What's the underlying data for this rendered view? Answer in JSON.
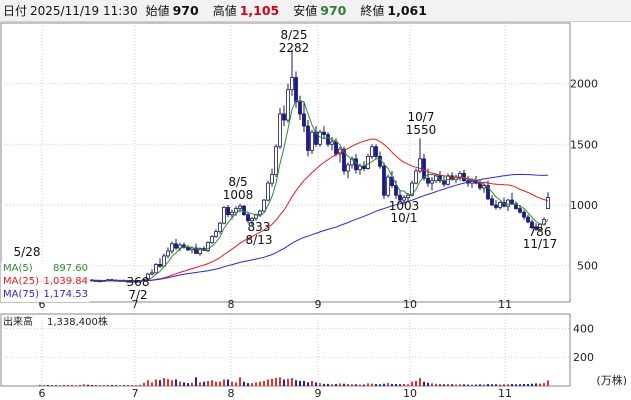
{
  "header": {
    "date_label": "日付",
    "date": "2025/11/19 11:30",
    "open_label": "始値",
    "open": "970",
    "high_label": "高値",
    "high": "1,105",
    "low_label": "安値",
    "low": "970",
    "close_label": "終値",
    "close": "1,061"
  },
  "colors": {
    "high": "#d0021b",
    "low": "#2e7d32",
    "up_candle": "#ffffff",
    "down_candle": "#1a1aa0",
    "ma5": "#2e8b2e",
    "ma25": "#e02020",
    "ma75": "#2a2ad0",
    "vol_up": "#e03030",
    "vol_down": "#2020a0"
  },
  "legend": [
    {
      "name": "MA(5)",
      "value": "897.60",
      "key": "ma5"
    },
    {
      "name": "MA(25)",
      "value": "1,039.84",
      "key": "ma25"
    },
    {
      "name": "MA(75)",
      "value": "1,174.53",
      "key": "ma75"
    }
  ],
  "volume_legend": {
    "label": "出来高",
    "value": "1,338,400株"
  },
  "chart_data": {
    "type": "candlestick",
    "x_ticks": [
      "6",
      "7",
      "8",
      "9",
      "10",
      "11"
    ],
    "price_ticks": [
      500,
      1000,
      1500,
      2000
    ],
    "ylim": [
      200,
      2500
    ],
    "volume_ticks": [
      200,
      400
    ],
    "volume_unit": "(万株)",
    "volume_ylim": [
      0,
      500
    ],
    "annotations": [
      {
        "date": "5/28",
        "value": ""
      },
      {
        "date": "7/2",
        "value": "368"
      },
      {
        "date": "8/5",
        "value": "1008"
      },
      {
        "date": "8/13",
        "value": "833"
      },
      {
        "date": "8/25",
        "value": "2282"
      },
      {
        "date": "10/1",
        "value": "1003"
      },
      {
        "date": "10/7",
        "value": "1550"
      },
      {
        "date": "11/17",
        "value": "786"
      }
    ],
    "candles": [
      [
        40,
        370,
        378,
        364,
        372,
        8
      ],
      [
        44,
        372,
        380,
        366,
        375,
        6
      ],
      [
        48,
        375,
        382,
        368,
        371,
        7
      ],
      [
        52,
        371,
        378,
        365,
        369,
        5
      ],
      [
        56,
        369,
        375,
        362,
        368,
        6
      ],
      [
        60,
        368,
        374,
        361,
        370,
        5
      ],
      [
        64,
        370,
        380,
        366,
        376,
        7
      ],
      [
        68,
        376,
        385,
        370,
        379,
        8
      ],
      [
        72,
        379,
        386,
        372,
        373,
        6
      ],
      [
        76,
        373,
        380,
        367,
        374,
        5
      ],
      [
        80,
        374,
        382,
        369,
        380,
        7
      ],
      [
        84,
        380,
        395,
        375,
        388,
        12
      ],
      [
        88,
        388,
        398,
        378,
        382,
        9
      ],
      [
        92,
        382,
        390,
        374,
        377,
        7
      ],
      [
        96,
        377,
        384,
        370,
        372,
        6
      ],
      [
        100,
        372,
        379,
        366,
        375,
        5
      ],
      [
        104,
        375,
        382,
        369,
        378,
        6
      ],
      [
        108,
        378,
        390,
        372,
        384,
        8
      ],
      [
        112,
        384,
        392,
        376,
        380,
        7
      ],
      [
        116,
        380,
        386,
        372,
        375,
        6
      ],
      [
        120,
        375,
        382,
        368,
        378,
        5
      ],
      [
        124,
        378,
        385,
        370,
        372,
        6
      ],
      [
        128,
        372,
        378,
        366,
        370,
        5
      ],
      [
        132,
        370,
        375,
        365,
        371,
        6
      ],
      [
        136,
        371,
        378,
        366,
        370,
        5
      ],
      [
        140,
        370,
        376,
        365,
        372,
        8
      ],
      [
        144,
        372,
        390,
        368,
        385,
        22
      ],
      [
        148,
        385,
        440,
        380,
        430,
        40
      ],
      [
        152,
        430,
        470,
        420,
        440,
        25
      ],
      [
        156,
        440,
        520,
        435,
        510,
        45
      ],
      [
        160,
        510,
        560,
        480,
        495,
        40
      ],
      [
        164,
        495,
        600,
        490,
        580,
        55
      ],
      [
        168,
        580,
        650,
        560,
        620,
        48
      ],
      [
        172,
        620,
        700,
        600,
        680,
        40
      ],
      [
        176,
        680,
        720,
        630,
        645,
        45
      ],
      [
        180,
        645,
        690,
        620,
        670,
        30
      ],
      [
        184,
        670,
        690,
        640,
        650,
        25
      ],
      [
        188,
        650,
        670,
        620,
        630,
        20
      ],
      [
        192,
        630,
        660,
        600,
        645,
        22
      ],
      [
        196,
        645,
        680,
        620,
        600,
        60
      ],
      [
        200,
        600,
        650,
        580,
        640,
        25
      ],
      [
        204,
        640,
        660,
        620,
        625,
        30
      ],
      [
        208,
        625,
        700,
        610,
        690,
        35
      ],
      [
        212,
        690,
        750,
        680,
        740,
        40
      ],
      [
        216,
        740,
        800,
        730,
        780,
        30
      ],
      [
        220,
        780,
        860,
        760,
        850,
        30
      ],
      [
        224,
        850,
        990,
        840,
        980,
        45
      ],
      [
        228,
        980,
        1000,
        900,
        920,
        45
      ],
      [
        232,
        920,
        960,
        880,
        940,
        30
      ],
      [
        236,
        940,
        990,
        910,
        970,
        25
      ],
      [
        240,
        970,
        1008,
        940,
        990,
        60
      ],
      [
        244,
        990,
        1000,
        910,
        920,
        30
      ],
      [
        248,
        920,
        940,
        850,
        870,
        20
      ],
      [
        252,
        870,
        900,
        833,
        890,
        20
      ],
      [
        256,
        890,
        930,
        870,
        920,
        25
      ],
      [
        260,
        920,
        960,
        900,
        950,
        30
      ],
      [
        264,
        950,
        1050,
        940,
        1040,
        35
      ],
      [
        268,
        1040,
        1200,
        1030,
        1180,
        45
      ],
      [
        272,
        1180,
        1300,
        1150,
        1250,
        50
      ],
      [
        276,
        1250,
        1500,
        1230,
        1480,
        55
      ],
      [
        280,
        1480,
        1800,
        1460,
        1750,
        60
      ],
      [
        284,
        1750,
        1820,
        1650,
        1700,
        45
      ],
      [
        288,
        1700,
        2000,
        1680,
        1950,
        50
      ],
      [
        292,
        1950,
        2282,
        1900,
        2050,
        55
      ],
      [
        296,
        2050,
        2100,
        1800,
        1850,
        40
      ],
      [
        300,
        1850,
        1900,
        1700,
        1750,
        35
      ],
      [
        304,
        1750,
        1850,
        1600,
        1650,
        35
      ],
      [
        308,
        1650,
        1700,
        1400,
        1450,
        25
      ],
      [
        312,
        1450,
        1620,
        1420,
        1600,
        35
      ],
      [
        316,
        1600,
        1650,
        1480,
        1500,
        25
      ],
      [
        320,
        1500,
        1620,
        1480,
        1600,
        20
      ],
      [
        324,
        1600,
        1650,
        1550,
        1580,
        15
      ],
      [
        328,
        1580,
        1600,
        1480,
        1500,
        15
      ],
      [
        332,
        1500,
        1560,
        1450,
        1520,
        12
      ],
      [
        336,
        1520,
        1550,
        1400,
        1420,
        14
      ],
      [
        340,
        1420,
        1480,
        1350,
        1460,
        18
      ],
      [
        344,
        1460,
        1480,
        1250,
        1280,
        16
      ],
      [
        348,
        1280,
        1350,
        1220,
        1330,
        14
      ],
      [
        352,
        1330,
        1400,
        1300,
        1380,
        12
      ],
      [
        356,
        1380,
        1420,
        1260,
        1290,
        12
      ],
      [
        360,
        1290,
        1340,
        1250,
        1320,
        10
      ],
      [
        364,
        1320,
        1360,
        1280,
        1300,
        10
      ],
      [
        368,
        1300,
        1420,
        1290,
        1400,
        18
      ],
      [
        372,
        1400,
        1500,
        1380,
        1480,
        16
      ],
      [
        376,
        1480,
        1500,
        1380,
        1400,
        14
      ],
      [
        380,
        1400,
        1440,
        1300,
        1320,
        12
      ],
      [
        384,
        1320,
        1350,
        1050,
        1080,
        16
      ],
      [
        388,
        1080,
        1250,
        1060,
        1230,
        20
      ],
      [
        392,
        1230,
        1280,
        1140,
        1160,
        14
      ],
      [
        396,
        1160,
        1200,
        1050,
        1080,
        14
      ],
      [
        400,
        1080,
        1120,
        1020,
        1040,
        12
      ],
      [
        404,
        1040,
        1080,
        1003,
        1060,
        14
      ],
      [
        408,
        1060,
        1100,
        1030,
        1080,
        12
      ],
      [
        412,
        1080,
        1200,
        1070,
        1180,
        30
      ],
      [
        416,
        1180,
        1300,
        1170,
        1280,
        35
      ],
      [
        420,
        1280,
        1550,
        1260,
        1380,
        55
      ],
      [
        424,
        1380,
        1420,
        1200,
        1220,
        30
      ],
      [
        428,
        1220,
        1300,
        1150,
        1180,
        22
      ],
      [
        432,
        1180,
        1230,
        1120,
        1200,
        18
      ],
      [
        436,
        1200,
        1260,
        1180,
        1240,
        15
      ],
      [
        440,
        1240,
        1280,
        1180,
        1200,
        12
      ],
      [
        444,
        1200,
        1240,
        1150,
        1170,
        12
      ],
      [
        448,
        1170,
        1260,
        1160,
        1240,
        14
      ],
      [
        452,
        1240,
        1270,
        1200,
        1210,
        12
      ],
      [
        456,
        1210,
        1250,
        1180,
        1230,
        10
      ],
      [
        460,
        1230,
        1280,
        1200,
        1260,
        12
      ],
      [
        464,
        1260,
        1290,
        1190,
        1200,
        12
      ],
      [
        468,
        1200,
        1240,
        1150,
        1180,
        10
      ],
      [
        472,
        1180,
        1220,
        1140,
        1200,
        10
      ],
      [
        476,
        1200,
        1240,
        1170,
        1180,
        10
      ],
      [
        480,
        1180,
        1210,
        1120,
        1140,
        12
      ],
      [
        484,
        1140,
        1180,
        1100,
        1160,
        10
      ],
      [
        488,
        1160,
        1200,
        1040,
        1050,
        14
      ],
      [
        492,
        1050,
        1080,
        990,
        1000,
        12
      ],
      [
        496,
        1000,
        1040,
        960,
        980,
        12
      ],
      [
        500,
        980,
        1030,
        960,
        1020,
        10
      ],
      [
        504,
        1020,
        1060,
        980,
        990,
        10
      ],
      [
        508,
        990,
        1050,
        950,
        1040,
        12
      ],
      [
        512,
        1040,
        1100,
        1000,
        1010,
        14
      ],
      [
        516,
        1010,
        1030,
        960,
        970,
        12
      ],
      [
        520,
        970,
        1000,
        930,
        940,
        12
      ],
      [
        524,
        940,
        960,
        880,
        900,
        14
      ],
      [
        528,
        900,
        920,
        850,
        860,
        14
      ],
      [
        532,
        860,
        880,
        800,
        820,
        16
      ],
      [
        536,
        820,
        850,
        786,
        800,
        18
      ],
      [
        540,
        800,
        850,
        790,
        840,
        16
      ],
      [
        544,
        840,
        900,
        830,
        880,
        20
      ],
      [
        548,
        970,
        1105,
        970,
        1061,
        38
      ]
    ]
  }
}
